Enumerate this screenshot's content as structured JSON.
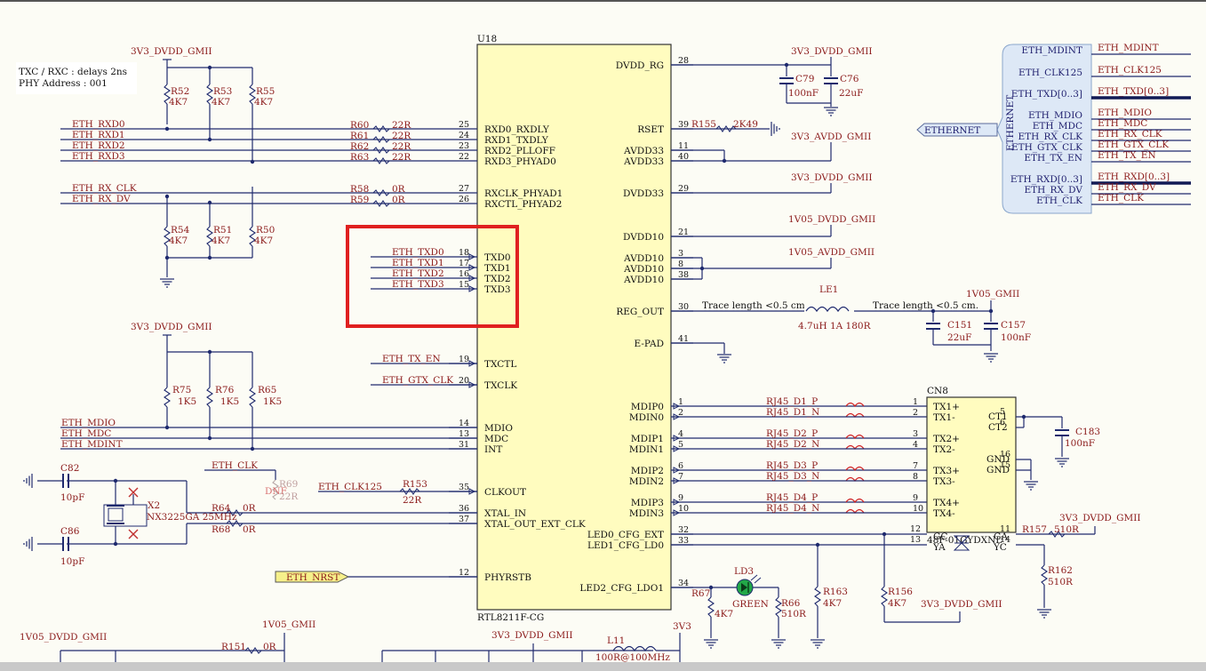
{
  "notes": [
    "TXC / RXC : delays 2ns",
    "PHY Address : 001"
  ],
  "chip": {
    "ref": "U18",
    "part": "RTL8211F-CG",
    "left_pins": [
      {
        "num": "25",
        "name": "RXD0_RXDLY"
      },
      {
        "num": "24",
        "name": "RXD1_TXDLY"
      },
      {
        "num": "23",
        "name": "RXD2_PLLOFF"
      },
      {
        "num": "22",
        "name": "RXD3_PHYAD0"
      },
      {
        "num": "27",
        "name": "RXCLK_PHYAD1"
      },
      {
        "num": "26",
        "name": "RXCTL_PHYAD2"
      },
      {
        "num": "18",
        "name": "TXD0"
      },
      {
        "num": "17",
        "name": "TXD1"
      },
      {
        "num": "16",
        "name": "TXD2"
      },
      {
        "num": "15",
        "name": "TXD3"
      },
      {
        "num": "19",
        "name": "TXCTL"
      },
      {
        "num": "20",
        "name": "TXCLK"
      },
      {
        "num": "14",
        "name": "MDIO"
      },
      {
        "num": "13",
        "name": "MDC"
      },
      {
        "num": "31",
        "name": "INT"
      },
      {
        "num": "35",
        "name": "CLKOUT"
      },
      {
        "num": "36",
        "name": "XTAL_IN"
      },
      {
        "num": "37",
        "name": "XTAL_OUT_EXT_CLK"
      },
      {
        "num": "12",
        "name": "PHYRSTB"
      }
    ],
    "right_pins": [
      {
        "num": "28",
        "name": "DVDD_RG"
      },
      {
        "num": "39",
        "name": "RSET"
      },
      {
        "num": "11",
        "name": "AVDD33"
      },
      {
        "num": "40",
        "name": "AVDD33"
      },
      {
        "num": "29",
        "name": "DVDD33"
      },
      {
        "num": "21",
        "name": "DVDD10"
      },
      {
        "num": "3",
        "name": "AVDD10"
      },
      {
        "num": "8",
        "name": "AVDD10"
      },
      {
        "num": "38",
        "name": "AVDD10"
      },
      {
        "num": "30",
        "name": "REG_OUT"
      },
      {
        "num": "41",
        "name": "E-PAD"
      },
      {
        "num": "1",
        "name": "MDIP0"
      },
      {
        "num": "2",
        "name": "MDIN0"
      },
      {
        "num": "4",
        "name": "MDIP1"
      },
      {
        "num": "5",
        "name": "MDIN1"
      },
      {
        "num": "6",
        "name": "MDIP2"
      },
      {
        "num": "7",
        "name": "MDIN2"
      },
      {
        "num": "9",
        "name": "MDIP3"
      },
      {
        "num": "10",
        "name": "MDIN3"
      },
      {
        "num": "32",
        "name": "LED0_CFG_EXT"
      },
      {
        "num": "33",
        "name": "LED1_CFG_LD0"
      },
      {
        "num": "34",
        "name": "LED2_CFG_LDO1"
      }
    ]
  },
  "nets": {
    "rxd": [
      "ETH_RXD0",
      "ETH_RXD1",
      "ETH_RXD2",
      "ETH_RXD3"
    ],
    "rxclk": "ETH_RX_CLK",
    "rxdv": "ETH_RX_DV",
    "txd": [
      "ETH_TXD0",
      "ETH_TXD1",
      "ETH_TXD2",
      "ETH_TXD3"
    ],
    "txen": "ETH_TX_EN",
    "gtxclk": "ETH_GTX_CLK",
    "mdio": "ETH_MDIO",
    "mdc": "ETH_MDC",
    "mdint": "ETH_MDINT",
    "ethclk": "ETH_CLK",
    "clk125": "ETH_CLK125",
    "nrst": "ETH_NRST",
    "pairs": [
      "RJ45_D1_P",
      "RJ45_D1_N",
      "RJ45_D2_P",
      "RJ45_D2_N",
      "RJ45_D3_P",
      "RJ45_D3_N",
      "RJ45_D4_P",
      "RJ45_D4_N"
    ]
  },
  "power": {
    "v33_gmii": "3V3_DVDD_GMII",
    "v33_avdd": "3V3_AVDD_GMII",
    "v105_dvdd": "1V05_DVDD_GMII",
    "v105_avdd": "1V05_AVDD_GMII",
    "v105_gmii": "1V05_GMII",
    "v105_dvdd_b": "1V05_DVDD_GMII",
    "v33": "3V3"
  },
  "resistors": {
    "r52": "R52",
    "r53": "R53",
    "r55": "R55",
    "r54": "R54",
    "r51": "R51",
    "r50": "R50",
    "r75": "R75",
    "r76": "R76",
    "r65": "R65",
    "v4k7": "4K7",
    "v1k5": "1K5",
    "r60": "R60",
    "r61": "R61",
    "r62": "R62",
    "r63": "R63",
    "v22r": "22R",
    "r58": "R58",
    "r59": "R59",
    "v0r": "0R",
    "r155": "R155",
    "v2k49": "2K49",
    "r69": "R69",
    "dnf": "DNF",
    "r153": "R153",
    "r64": "R64",
    "r68": "R68",
    "r67": "R67",
    "r66": "R66",
    "v510r": "510R",
    "r163": "R163",
    "r156": "R156",
    "r157": "R157",
    "r162": "R162",
    "r151": "R151"
  },
  "caps": {
    "c79": "C79",
    "v100nf": "100nF",
    "c76": "C76",
    "v22uf": "22uF",
    "c151": "C151",
    "c157": "C157",
    "c183": "C183",
    "c82": "C82",
    "c86": "C86",
    "v10pf": "10pF"
  },
  "inductors": {
    "le1": "LE1",
    "le1_val": "4.7uH 1A 180R",
    "l11": "L11",
    "l11_val": "100R@100MHz"
  },
  "trace_note": "Trace length <0.5 cm.",
  "crystal": {
    "ref": "X2",
    "part": "NX3225GA 25MHz"
  },
  "led": {
    "ref": "LD3",
    "color": "GREEN"
  },
  "connector": {
    "ref": "CN8",
    "part": "48F-01GYDXNL",
    "pins_left": [
      {
        "num": "1",
        "name": "TX1+"
      },
      {
        "num": "2",
        "name": "TX1-"
      },
      {
        "num": "3",
        "name": "TX2+"
      },
      {
        "num": "4",
        "name": "TX2-"
      },
      {
        "num": "7",
        "name": "TX3+"
      },
      {
        "num": "8",
        "name": "TX3-"
      },
      {
        "num": "9",
        "name": "TX4+"
      },
      {
        "num": "10",
        "name": "TX4-"
      }
    ],
    "ct": [
      "CT1",
      "CT2"
    ],
    "ct_nums": [
      "5",
      "6"
    ],
    "gnd": [
      "GND",
      "GND"
    ],
    "gnd_nums": [
      "16",
      "15"
    ],
    "led_pins": [
      {
        "num": "12",
        "name": "GC"
      },
      {
        "num": "13",
        "name": "YA"
      },
      {
        "num": "11",
        "name": "GA"
      },
      {
        "num": "14",
        "name": "YC"
      }
    ]
  },
  "bus": {
    "title": "ETHERNET",
    "entries": [
      "ETH_MDINT",
      "ETH_CLK125",
      "ETH_TXD[0..3]",
      "ETH_MDIO",
      "ETH_MDC",
      "ETH_RX_CLK",
      "ETH_GTX_CLK",
      "ETH_TX_EN",
      "ETH_RXD[0..3]",
      "ETH_RX_DV",
      "ETH_CLK"
    ],
    "labels": [
      "ETH_MDINT",
      "ETH_CLK125",
      "ETH_TXD[0..3]",
      "ETH_MDIO",
      "ETH_MDC",
      "ETH_RX_CLK",
      "ETH_GTX_CLK",
      "ETH_TX_EN",
      "ETH_RXD[0..3]",
      "ETH_RX_DV",
      "ETH_CLK"
    ]
  },
  "highlight_color": "#e02020"
}
